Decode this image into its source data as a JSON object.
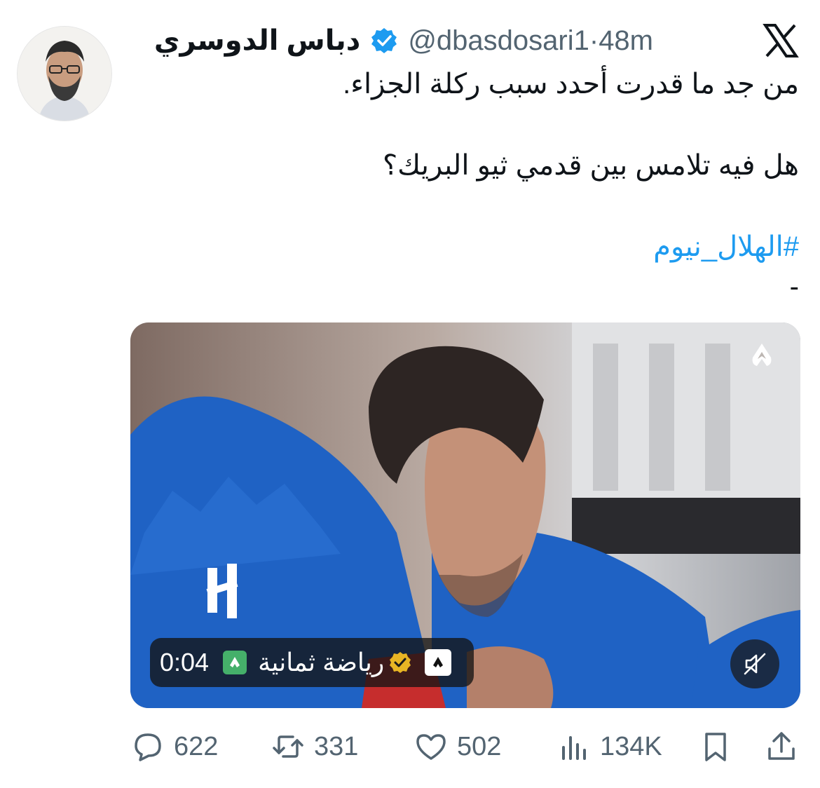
{
  "author": {
    "name": "دباس الدوسري",
    "handle": "@dbasdosari1",
    "separator": "·",
    "time": "48m"
  },
  "tweet": {
    "line1": "من جد ما قدرت أحدد سبب ركلة الجزاء.",
    "line2": "هل فيه تلامس بين قدمي ثيو البريك؟",
    "hashtag": "#الهلال_نيوم",
    "trailing": "-"
  },
  "video": {
    "duration": "0:04",
    "channel_name": "رياضة ثمانية",
    "sound": "muted"
  },
  "actions": {
    "replies": "622",
    "retweets": "331",
    "likes": "502",
    "views": "134K"
  },
  "colors": {
    "accent": "#1d9bf0",
    "secondary_text": "#536471",
    "verified": "#1d9bf0",
    "jersey": "#1f62c4"
  },
  "icons": [
    "x-logo-icon",
    "verified-badge-icon",
    "reply-icon",
    "retweet-icon",
    "like-icon",
    "views-icon",
    "bookmark-icon",
    "share-icon",
    "mute-icon"
  ]
}
